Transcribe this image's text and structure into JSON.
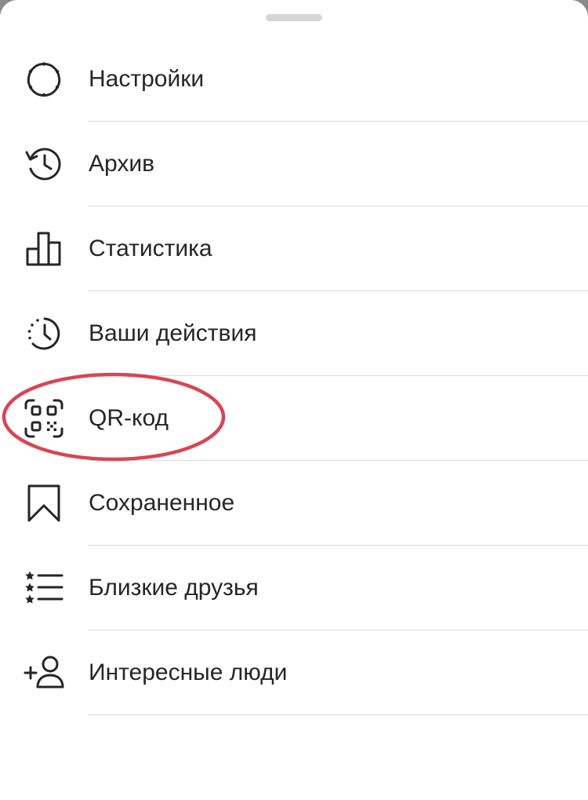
{
  "menu": {
    "items": [
      {
        "label": "Настройки",
        "icon": "gear-icon"
      },
      {
        "label": "Архив",
        "icon": "history-icon"
      },
      {
        "label": "Статистика",
        "icon": "bar-chart-icon"
      },
      {
        "label": "Ваши действия",
        "icon": "activity-clock-icon"
      },
      {
        "label": "QR-код",
        "icon": "qr-code-icon"
      },
      {
        "label": "Сохраненное",
        "icon": "bookmark-icon"
      },
      {
        "label": "Близкие друзья",
        "icon": "starred-list-icon"
      },
      {
        "label": "Интересные люди",
        "icon": "add-person-icon"
      }
    ]
  },
  "colors": {
    "text": "#262626",
    "divider": "#dbdbdb",
    "highlight": "#d94552",
    "grabber": "#d6d6d6"
  }
}
